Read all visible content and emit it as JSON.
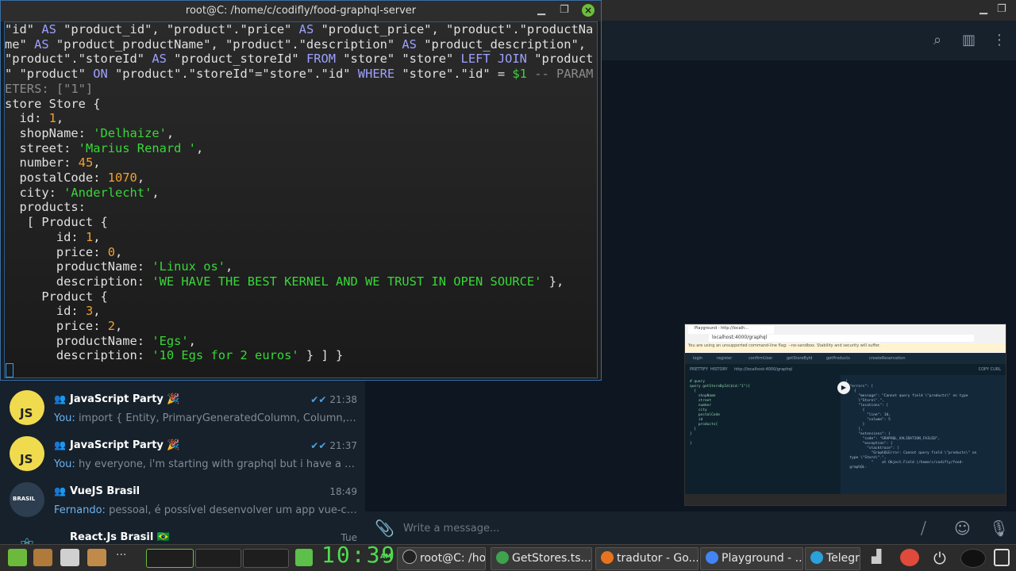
{
  "terminal": {
    "title": "root@C: /home/c/codifly/food-graphql-server",
    "close_icon": "×",
    "lines": [
      [
        [
          "s",
          "\"id\" "
        ],
        [
          "k",
          "AS"
        ],
        [
          "s",
          " \"product_id\", \"product\".\"price\" "
        ],
        [
          "k",
          "AS"
        ],
        [
          "s",
          " \"product_price\", \"product\".\"productNa"
        ]
      ],
      [
        [
          "s",
          "me\" "
        ],
        [
          "k",
          "AS"
        ],
        [
          "s",
          " \"product_productName\", \"product\".\"description\" "
        ],
        [
          "k",
          "AS"
        ],
        [
          "s",
          " \"product_description\","
        ]
      ],
      [
        [
          "s",
          "\"product\".\"storeId\" "
        ],
        [
          "k",
          "AS"
        ],
        [
          "s",
          " \"product_storeId\" "
        ],
        [
          "k",
          "FROM"
        ],
        [
          "s",
          " \"store\" \"store\" "
        ],
        [
          "k",
          "LEFT JOIN"
        ],
        [
          "s",
          " \"product"
        ]
      ],
      [
        [
          "s",
          "\" \"product\" "
        ],
        [
          "k",
          "ON"
        ],
        [
          "s",
          " \"product\".\"storeId\"=\"store\".\"id\" "
        ],
        [
          "k",
          "WHERE"
        ],
        [
          "s",
          " \"store\".\"id\" = "
        ],
        [
          "g",
          "$1"
        ],
        [
          "c",
          " -- PARAM"
        ]
      ],
      [
        [
          "c",
          "ETERS: [\"1\"]"
        ]
      ],
      [
        [
          "s",
          "store Store {"
        ]
      ],
      [
        [
          "s",
          "  id: "
        ],
        [
          "n",
          "1"
        ],
        [
          "s",
          ","
        ]
      ],
      [
        [
          "s",
          "  shopName: "
        ],
        [
          "g",
          "'Delhaize'"
        ],
        [
          "s",
          ","
        ]
      ],
      [
        [
          "s",
          "  street: "
        ],
        [
          "g",
          "'Marius Renard '"
        ],
        [
          "s",
          ","
        ]
      ],
      [
        [
          "s",
          "  number: "
        ],
        [
          "n",
          "45"
        ],
        [
          "s",
          ","
        ]
      ],
      [
        [
          "s",
          "  postalCode: "
        ],
        [
          "n",
          "1070"
        ],
        [
          "s",
          ","
        ]
      ],
      [
        [
          "s",
          "  city: "
        ],
        [
          "g",
          "'Anderlecht'"
        ],
        [
          "s",
          ","
        ]
      ],
      [
        [
          "s",
          "  products:"
        ]
      ],
      [
        [
          "s",
          "   [ Product {"
        ]
      ],
      [
        [
          "s",
          "       id: "
        ],
        [
          "n",
          "1"
        ],
        [
          "s",
          ","
        ]
      ],
      [
        [
          "s",
          "       price: "
        ],
        [
          "n",
          "0"
        ],
        [
          "s",
          ","
        ]
      ],
      [
        [
          "s",
          "       productName: "
        ],
        [
          "g",
          "'Linux os'"
        ],
        [
          "s",
          ","
        ]
      ],
      [
        [
          "s",
          "       description: "
        ],
        [
          "g",
          "'WE HAVE THE BEST KERNEL AND WE TRUST IN OPEN SOURCE'"
        ],
        [
          "s",
          " },"
        ]
      ],
      [
        [
          "s",
          "     Product {"
        ]
      ],
      [
        [
          "s",
          "       id: "
        ],
        [
          "n",
          "3"
        ],
        [
          "s",
          ","
        ]
      ],
      [
        [
          "s",
          "       price: "
        ],
        [
          "n",
          "2"
        ],
        [
          "s",
          ","
        ]
      ],
      [
        [
          "s",
          "       productName: "
        ],
        [
          "g",
          "'Egs'"
        ],
        [
          "s",
          ","
        ]
      ],
      [
        [
          "s",
          "       description: "
        ],
        [
          "g",
          "'10 Egs for 2 euros'"
        ],
        [
          "s",
          " } ] }"
        ]
      ]
    ]
  },
  "telegram": {
    "chats": [
      {
        "title": "JavaScript Party 🎉",
        "time": "21:38",
        "read": true,
        "sender": "You:",
        "preview": "import { Entity, PrimaryGeneratedColumn, Column, BaseEntity } from 'typeorm'",
        "avatar": "js"
      },
      {
        "title": "JavaScript Party 🎉",
        "time": "21:37",
        "read": true,
        "sender": "You:",
        "preview": "hy everyone, i'm starting with graphql but i have a problem with relations",
        "avatar": "js"
      },
      {
        "title": "VueJS Brasil",
        "time": "18:49",
        "read": false,
        "sender": "Fernando:",
        "preview": "pessoal, é possível desenvolver um app vue-cli usando typescript?",
        "avatar": "vue"
      },
      {
        "title": "React.Js Brasil 🇧🇷",
        "time": "Tue",
        "read": false,
        "sender": "",
        "preview": "",
        "avatar": "react"
      }
    ],
    "input_placeholder": "Write a message...",
    "read_check": "✔✔",
    "group_glyph": "👥",
    "avatar_js_text": "JS",
    "avatar_vue_text": "BRASIL",
    "avatar_react_glyph": "⚛"
  },
  "preview": {
    "tab_label": "Playground - http://localh...",
    "url": "localhost:4000/graphql",
    "warning": "You are using an unsupported command-line flag: --no-sandbox. Stability and security will suffer.",
    "tabs": [
      "login",
      "register",
      "confirmUser",
      "getStoreById",
      "getProducts",
      "createReservation"
    ],
    "prettify": "PRETTIFY",
    "history": "HISTORY",
    "endpoint": "http://localhost:4000/graphql",
    "copy_curl": "COPY CURL",
    "left_code": "# query\nquery getStoreById($id:\"1\"){\n  {\n    shopName\n    street\n    number\n    city\n    postalCode\n    id\n    products{\n  }\n}\n\n}",
    "right_code": "{\n  \"errors\": [\n    {\n      \"message\": \"Cannot query field \\\"products\\\" on type\n      \\\"Store\\\".\",\n      \"locations\": [\n        {\n          \"line\": 10,\n          \"column\": 5\n        }\n      ],\n      \"extensions\": {\n        \"code\": \"GRAPHQL_VALIDATION_FAILED\",\n        \"exception\": {\n          \"stacktrace\": [\n            \"GraphQLError: Cannot query field \\\"products\\\" on\n  type \\\"Store\\\".\",\n            \"    at Object.Field (/home/c/codifly/food-\n  graphQL-"
  },
  "taskbar": {
    "clock": "10:39",
    "clock_ampm": "AM",
    "tasks": [
      {
        "label": "root@C: /ho...",
        "color": "#222222"
      },
      {
        "label": "GetStores.ts...",
        "color": "#3fa34d"
      },
      {
        "label": "tradutor - Go...",
        "color": "#e8731f"
      },
      {
        "label": "Playground - ...",
        "color": "#4285f4"
      },
      {
        "label": "Telegram",
        "color": "#2aa1da"
      }
    ]
  },
  "colors": {
    "terminal_keyword": "#9ea0ff",
    "terminal_string": "#38d738",
    "terminal_number": "#f0a030",
    "telegram_link": "#6ab2f2"
  }
}
